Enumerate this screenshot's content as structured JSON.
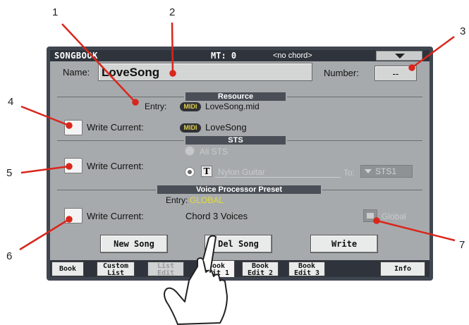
{
  "callouts": [
    "1",
    "2",
    "3",
    "4",
    "5",
    "6",
    "7"
  ],
  "titlebar": {
    "title": "SONGBOOK",
    "mt": "MT: 0",
    "chord": "<no chord>",
    "menu_icon": "triangle-down-icon"
  },
  "name": {
    "label": "Name:",
    "value": "LoveSong"
  },
  "number": {
    "label": "Number:",
    "value": "--"
  },
  "resource": {
    "header": "Resource",
    "entry_label": "Entry:",
    "entry_badge": "MIDI",
    "entry_value": "LoveSong.mid",
    "write_label": "Write Current:",
    "write_badge": "MIDI",
    "write_value": "LoveSong"
  },
  "sts": {
    "header": "STS",
    "write_label": "Write Current:",
    "all_sts": "All STS",
    "t_icon": "T",
    "sound": "Nylon Guitar",
    "to_label": "To:",
    "to_value": "STS1"
  },
  "voice": {
    "header": "Voice Processor Preset",
    "entry_label": "Entry:",
    "entry_value": "GLOBAL",
    "write_label": "Write Current:",
    "write_value": "Chord 3 Voices",
    "global_label": "Global",
    "entry_color": "#e3dc3a"
  },
  "buttons": {
    "new_song": "New Song",
    "del_song": "Del Song",
    "write": "Write"
  },
  "tabs": [
    {
      "l1": "Book",
      "l2": ""
    },
    {
      "l1": "Custom",
      "l2": "List"
    },
    {
      "l1": "List",
      "l2": "Edit"
    },
    {
      "l1": "Book",
      "l2": "Edit 1"
    },
    {
      "l1": "Book",
      "l2": "Edit 2"
    },
    {
      "l1": "Book",
      "l2": "Edit 3"
    },
    {
      "l1": "Info",
      "l2": ""
    }
  ],
  "colors": {
    "callout_line": "#d9261c",
    "screen_bg": "#a7aaac",
    "titlebar_bg": "#2f343c"
  },
  "hand_icon": "pointing-hand-icon"
}
